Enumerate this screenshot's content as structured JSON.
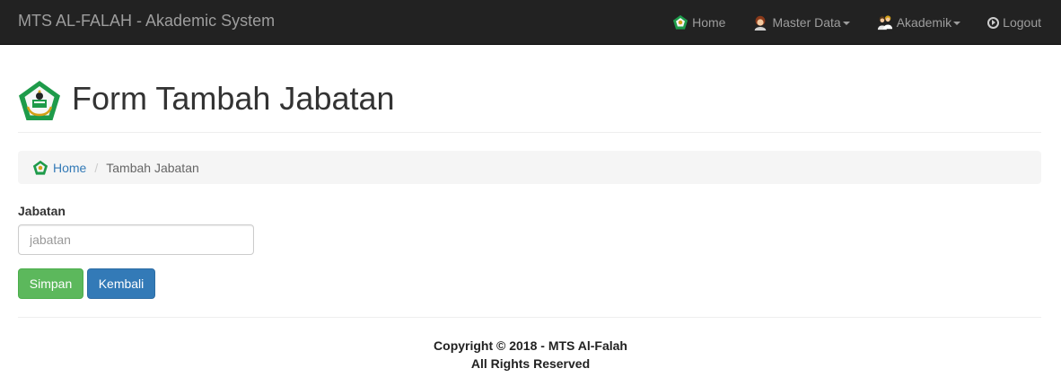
{
  "navbar": {
    "brand": "MTS AL-FALAH - Akademic System",
    "items": [
      {
        "label": "Home",
        "icon": "pentagon-logo-icon"
      },
      {
        "label": "Master Data",
        "icon": "user-avatar-icon",
        "dropdown": true
      },
      {
        "label": "Akademik",
        "icon": "students-icon",
        "dropdown": true
      },
      {
        "label": "Logout",
        "icon": "logout-icon"
      }
    ]
  },
  "header": {
    "title": "Form Tambah Jabatan",
    "logo_icon": "school-emblem-icon"
  },
  "breadcrumb": {
    "home": "Home",
    "current": "Tambah Jabatan"
  },
  "form": {
    "label": "Jabatan",
    "placeholder": "jabatan",
    "value": ""
  },
  "buttons": {
    "save": "Simpan",
    "back": "Kembali"
  },
  "footer": {
    "line1": "Copyright © 2018 - MTS Al-Falah",
    "line2": "All Rights Reserved"
  },
  "colors": {
    "navbar_bg": "#222222",
    "link": "#337ab7",
    "success": "#5cb85c",
    "primary": "#337ab7",
    "emblem_green": "#1e9b4a"
  }
}
